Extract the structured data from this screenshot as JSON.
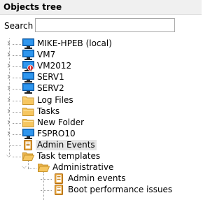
{
  "header": {
    "title": "Objects tree"
  },
  "search": {
    "label": "Search",
    "value": "",
    "placeholder": ""
  },
  "tree": {
    "nodes": [
      {
        "label": "MIKE-HPEB (local)",
        "icon": "computer-icon",
        "expanded": false
      },
      {
        "label": "VM7",
        "icon": "computer-icon",
        "expanded": false
      },
      {
        "label": "VM2012",
        "icon": "computer-error-icon",
        "expanded": false
      },
      {
        "label": "SERV1",
        "icon": "computer-icon",
        "expanded": false
      },
      {
        "label": "SERV2",
        "icon": "computer-icon",
        "expanded": false
      },
      {
        "label": "Log Files",
        "icon": "folder-icon",
        "expanded": false
      },
      {
        "label": "Tasks",
        "icon": "folder-icon",
        "expanded": false
      },
      {
        "label": "New Folder",
        "icon": "folder-icon",
        "expanded": false
      },
      {
        "label": "FSPRO10",
        "icon": "computer-icon",
        "expanded": false
      },
      {
        "label": "Admin Events",
        "icon": "document-icon",
        "selected": true
      },
      {
        "label": "Task templates",
        "icon": "folder-open-icon",
        "expanded": true
      },
      {
        "label": "Administrative",
        "icon": "folder-open-icon",
        "expanded": true
      },
      {
        "label": "Admin events",
        "icon": "document-icon"
      },
      {
        "label": "Boot performance issues",
        "icon": "document-icon"
      }
    ]
  },
  "colors": {
    "monitor": "#1a7fd8",
    "folder": "#f6c660",
    "error": "#d92b2b",
    "selection": "#e5e5e5"
  }
}
